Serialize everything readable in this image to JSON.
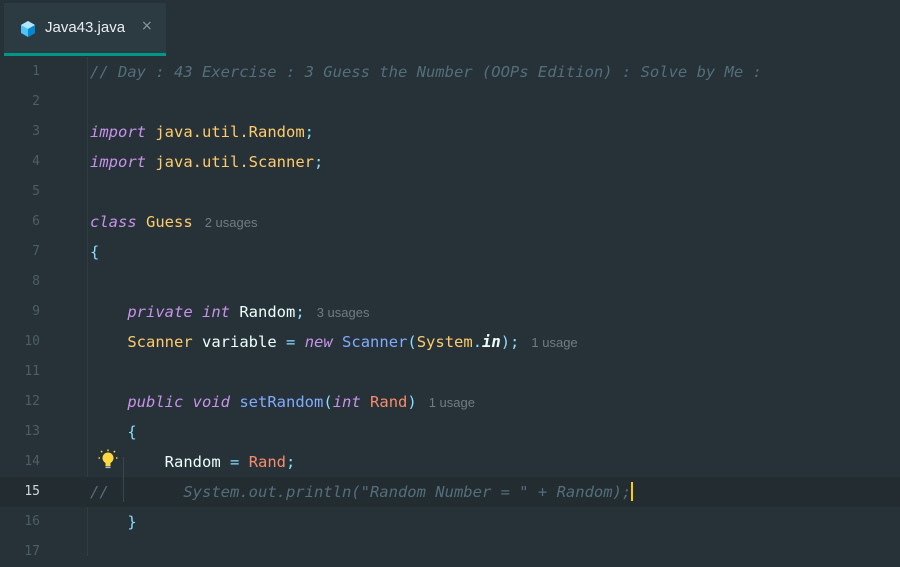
{
  "tab": {
    "title": "Java43.java",
    "close": "×",
    "icon": "java-file-icon"
  },
  "lines": [
    {
      "n": "1",
      "comment": "// Day : 43 Exercise : 3 Guess the Number (OOPs Edition) : Solve by Me :"
    },
    {
      "n": "2"
    },
    {
      "n": "3",
      "kw": "import",
      "pkg": "java.util.Random",
      "semi": ";"
    },
    {
      "n": "4",
      "kw": "import",
      "pkg": "java.util.Scanner",
      "semi": ";"
    },
    {
      "n": "5"
    },
    {
      "n": "6",
      "kw": "class",
      "name": "Guess",
      "hint": "2 usages"
    },
    {
      "n": "7",
      "brace": "{"
    },
    {
      "n": "8"
    },
    {
      "n": "9",
      "kw1": "private",
      "kw2": "int",
      "name": "Random",
      "semi": ";",
      "hint": "3 usages"
    },
    {
      "n": "10",
      "type": "Scanner",
      "name": "variable",
      "eq": "=",
      "kw": "new",
      "ctor": "Scanner",
      "arg1": "System",
      "dot": ".",
      "arg2": "in",
      "tail": ");",
      "hint": "1 usage"
    },
    {
      "n": "11"
    },
    {
      "n": "12",
      "kw1": "public",
      "kw2": "void",
      "fn": "setRandom",
      "p1": "int",
      "p2": "Rand",
      "hint": "1 usage"
    },
    {
      "n": "13",
      "brace": "{"
    },
    {
      "n": "14",
      "lhs": "Random",
      "eq": "=",
      "rhs": "Rand",
      "semi": ";"
    },
    {
      "n": "15",
      "prefix": "//",
      "comment": "System.out.println(\"Random Number = \" + Random);"
    },
    {
      "n": "16",
      "brace": "}"
    },
    {
      "n": "17"
    }
  ]
}
